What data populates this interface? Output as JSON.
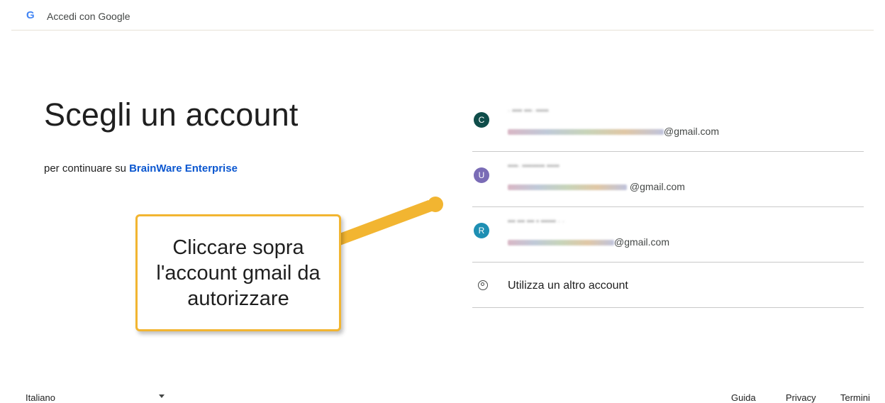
{
  "header": {
    "logo_letter": "G",
    "title": "Accedi con Google"
  },
  "main": {
    "title": "Scegli un account",
    "subtitle_prefix": "per continuare su ",
    "subtitle_link": "BrainWare Enterprise"
  },
  "accounts": [
    {
      "initial": "C",
      "avatar_color": "#0f4d4a",
      "email_suffix": "@gmail.com"
    },
    {
      "initial": "U",
      "avatar_color": "#7a6cb6",
      "email_suffix": "@gmail.com"
    },
    {
      "initial": "R",
      "avatar_color": "#1e8fb3",
      "email_suffix": "@gmail.com"
    }
  ],
  "other_account": {
    "label": "Utilizza un altro account",
    "icon": "account-circle-icon"
  },
  "callout": {
    "text": "Cliccare sopra l'account gmail da autorizzare",
    "border_color": "#f2b531"
  },
  "footer": {
    "language": "Italiano",
    "links": [
      "Guida",
      "Privacy",
      "Termini"
    ]
  }
}
